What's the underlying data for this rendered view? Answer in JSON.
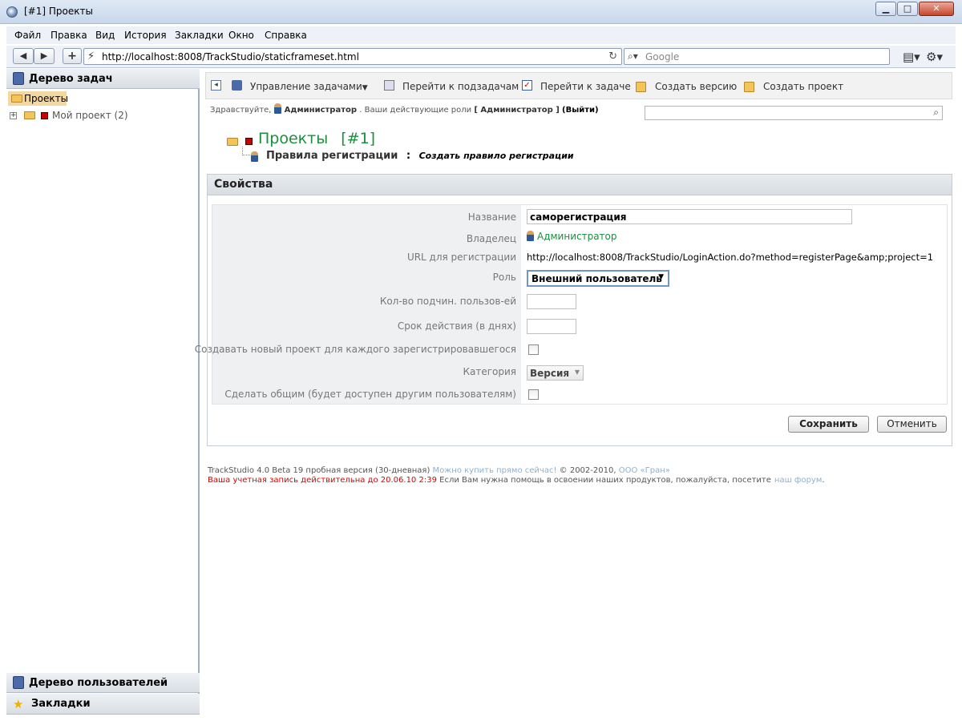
{
  "window": {
    "title": "[#1] Проекты",
    "min_label": "▁",
    "max_label": "□",
    "close_label": "✕"
  },
  "menubar": [
    "Файл",
    "Правка",
    "Вид",
    "История",
    "Закладки",
    "Окно",
    "Справка"
  ],
  "navbar": {
    "back_icon": "◀",
    "forward_icon": "▶",
    "add_icon": "+",
    "url": "http://localhost:8008/TrackStudio/staticframeset.html",
    "reload_icon": "↻",
    "search_placeholder": "Google"
  },
  "left": {
    "task_tree_title": "Дерево задач",
    "root": "Проекты",
    "child": "Мой проект (2)",
    "user_tree_title": "Дерево пользователей",
    "bookmarks_title": "Закладки"
  },
  "toolbar": {
    "manage": "Управление задачами",
    "subtasks": "Перейти к подзадачам",
    "goto_task": "Перейти к задаче",
    "create_version": "Создать версию",
    "create_project": "Создать проект"
  },
  "greeting": {
    "hello": "Здравствуйте,",
    "user": "Администратор",
    "roles_text": ". Ваши действующие роли",
    "roles": "[ Администратор ]",
    "logout": "(Выйти)"
  },
  "breadcrumb": {
    "title": "Проекты",
    "number": "[#1]",
    "section": "Правила регистрации",
    "separator": ":",
    "action": "Создать правило регистрации"
  },
  "properties": {
    "header": "Свойства",
    "fields": {
      "name_label": "Название",
      "name_value": "саморегистрация",
      "owner_label": "Владелец",
      "owner_value": "Администратор",
      "url_label": "URL для регистрации",
      "url_value": "http://localhost:8008/TrackStudio/LoginAction.do?method=registerPage&amp;project=1",
      "role_label": "Роль",
      "role_value": "Внешний пользователь",
      "subordinate_label": "Кол-во подчин. пользов-ей",
      "expiry_label": "Срок действия (в днях)",
      "new_project_label": "Создавать новый проект для каждого зарегистрировавшегося",
      "category_label": "Категория",
      "category_value": "Версия",
      "shared_label": "Сделать общим (будет доступен другим пользователям)"
    },
    "save_label": "Сохранить",
    "cancel_label": "Отменить"
  },
  "footer": {
    "line1_text": "TrackStudio 4.0 Beta 19 пробная версия (30-дневная)",
    "line1_link": "Можно купить прямо сейчас!",
    "line1_copy": "© 2002-2010,",
    "line1_company": "ООО «Гран»",
    "line2_warning": "Ваша учетная запись действительна до 20.06.10 2:39",
    "line2_text": "Если Вам нужна помощь в освоении наших продуктов, пожалуйста, посетите",
    "line2_link": "наш форум",
    "line2_end": "."
  },
  "icons": {
    "back": "arrow-left-icon",
    "forward": "arrow-right-icon",
    "reload": "reload-icon",
    "search": "search-icon",
    "page": "page-icon",
    "gear": "gear-icon",
    "folder": "folder-icon",
    "star": "star-icon",
    "user": "user-icon"
  }
}
